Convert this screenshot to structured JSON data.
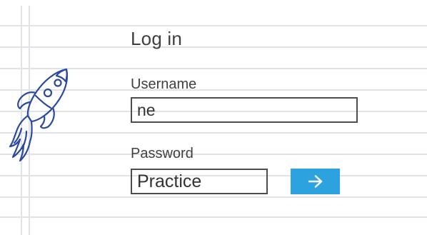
{
  "form": {
    "title": "Log in",
    "username_label": "Username",
    "username_value": "ne",
    "password_label": "Password",
    "password_value": "Practice",
    "submit_icon": "arrow-right-icon"
  },
  "colors": {
    "accent": "#2ca3df",
    "text": "#3f3f3f",
    "rule_lines": "#dfe3e8",
    "sketch_ink": "#2b4a9e"
  }
}
